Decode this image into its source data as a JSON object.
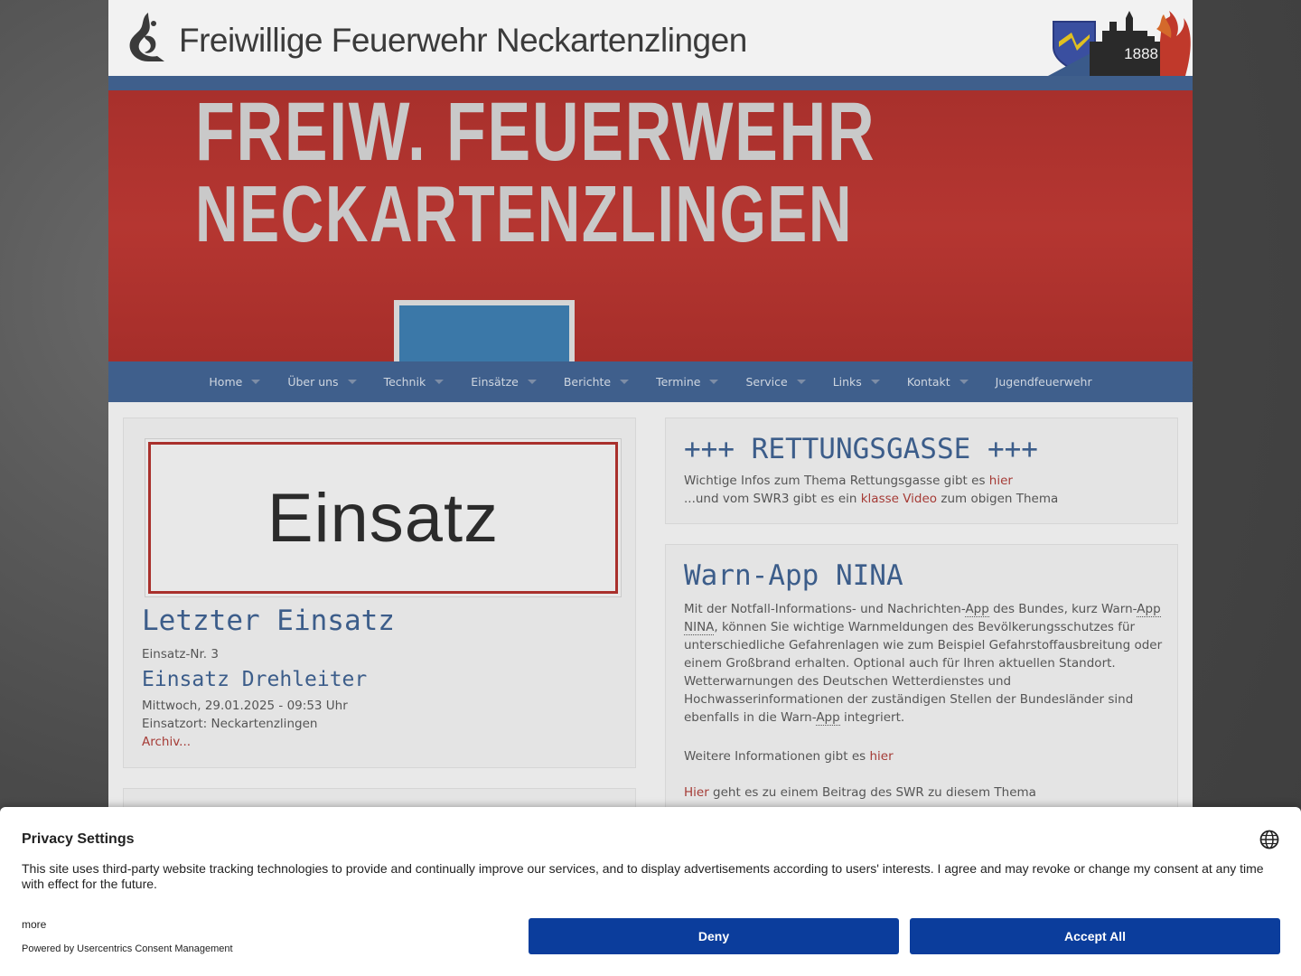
{
  "header": {
    "site_title": "Freiwillige Feuerwehr Neckartenzlingen",
    "crest_year": "1888"
  },
  "hero": {
    "line1": "FREIW. FEUERWEHR",
    "line2": "NECKARTENZLINGEN",
    "line3": "NECKARTENZLINGEN"
  },
  "nav": {
    "items": [
      {
        "label": "Home"
      },
      {
        "label": "Über uns"
      },
      {
        "label": "Technik"
      },
      {
        "label": "Einsätze"
      },
      {
        "label": "Berichte"
      },
      {
        "label": "Termine"
      },
      {
        "label": "Service"
      },
      {
        "label": "Links"
      },
      {
        "label": "Kontakt"
      },
      {
        "label": "Jugendfeuerwehr"
      }
    ]
  },
  "left_panel": {
    "image_text": "Einsatz",
    "title": "Letzter Einsatz",
    "number": "Einsatz-Nr. 3",
    "subtitle": "Einsatz Drehleiter",
    "datetime": "Mittwoch, 29.01.2025 - 09:53 Uhr",
    "location": "Einsatzort: Neckartenzlingen",
    "archive_link": "Archiv..."
  },
  "rettungsgasse": {
    "title": "+++ RETTUNGSGASSE +++",
    "line1_prefix": "Wichtige Infos zum Thema Rettungsgasse gibt es ",
    "line1_link": "hier",
    "line2_prefix": "...und vom SWR3 gibt es ein ",
    "line2_link": "klasse Video",
    "line2_suffix": " zum obigen Thema"
  },
  "nina": {
    "title": "Warn-App NINA",
    "p1_a": "Mit der Notfall-Informations- und Nachrichten-",
    "abbr_app": "App",
    "p1_b": " des Bundes, kurz Warn-",
    "abbr_nina": "App NINA",
    "p1_c": ", können Sie wichtige Warnmeldungen des Bevölkerungsschutzes für unterschiedliche Gefahrenlagen wie zum Beispiel Gefahrstoffausbreitung oder einem Großbrand erhalten. Optional auch für Ihren aktuellen Standort. Wetterwarnungen des Deutschen Wetterdienstes und Hochwasserinformationen der zuständigen Stellen der Bundesländer sind ebenfalls in die Warn-",
    "p1_d": " integriert.",
    "p2_prefix": "Weitere Informationen gibt es ",
    "p2_link": "hier",
    "p3_link": "Hier",
    "p3_suffix": " geht es zu einem Beitrag des SWR zu diesem Thema"
  },
  "consent": {
    "title": "Privacy Settings",
    "body": "This site uses third-party website tracking technologies to provide and continually improve our services, and to display advertisements according to users' interests. I agree and may revoke or change my consent at any time with effect for the future.",
    "more": "more",
    "powered": "Powered by Usercentrics Consent Management",
    "deny": "Deny",
    "accept": "Accept All"
  },
  "colors": {
    "nav_blue": "#3f5f8c",
    "link_red": "#a53b36",
    "title_blue": "#3c5d8a",
    "button_blue": "#0b3d9c"
  }
}
